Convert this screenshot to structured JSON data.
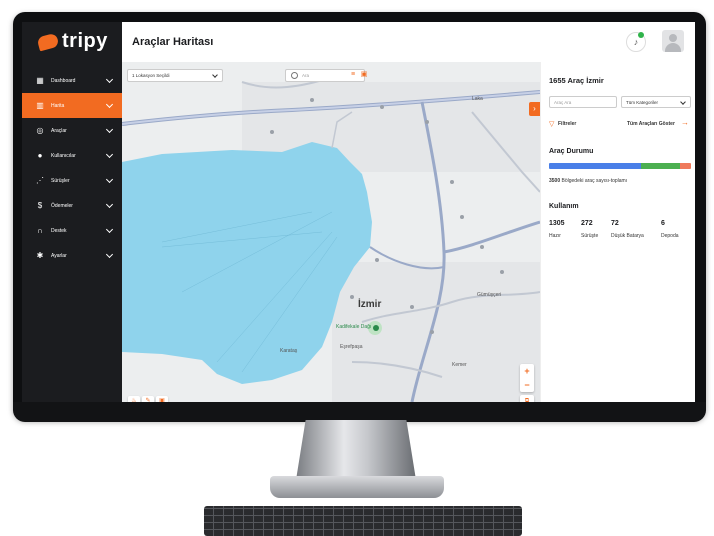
{
  "app": {
    "logo_text": "tripy",
    "page_title": "Araçlar Haritası"
  },
  "sidebar": {
    "items": [
      {
        "label": "Dashboard",
        "icon": "grid-icon",
        "active": false
      },
      {
        "label": "Harita",
        "icon": "map-icon",
        "active": true
      },
      {
        "label": "Araçlar",
        "icon": "scooter-icon",
        "active": false
      },
      {
        "label": "Kullanıcılar",
        "icon": "user-icon",
        "active": false
      },
      {
        "label": "Sürüşler",
        "icon": "route-icon",
        "active": false
      },
      {
        "label": "Ödemeler",
        "icon": "payment-icon",
        "active": false
      },
      {
        "label": "Destek",
        "icon": "headset-icon",
        "active": false
      },
      {
        "label": "Ayarlar",
        "icon": "gear-icon",
        "active": false
      }
    ]
  },
  "map": {
    "location_select": "1 Lokasyon Seçildi",
    "search_placeholder": "Ara",
    "city_label": "İzmir",
    "castle_label": "Kadifekale Dağı",
    "district_labels": [
      "Laka",
      "Karataş",
      "Eşrefpaşa",
      "Kemer",
      "Gümüşçeri"
    ]
  },
  "panel": {
    "title": "1655 Araç İzmir",
    "search_placeholder": "Araç Ara",
    "category_select": "Tüm Kategoriler",
    "filters_label": "Filtreler",
    "show_all_label": "Tüm Araçları Göster",
    "status_title": "Araç Durumu",
    "status_bar": [
      {
        "fraction": 0.65,
        "color": "#4a7fe8"
      },
      {
        "fraction": 0.27,
        "color": "#4caf50"
      },
      {
        "fraction": 0.08,
        "color": "#ef7a5c"
      }
    ],
    "count_value": "3500",
    "count_text": "Bölgedeki araç sayısı-toplamı",
    "usage_title": "Kullanım",
    "usage": [
      {
        "value": "1305",
        "label": "Hazır"
      },
      {
        "value": "272",
        "label": "Sürüşte"
      },
      {
        "value": "72",
        "label": "Düşük Batarya"
      },
      {
        "value": "6",
        "label": "Depoda"
      }
    ]
  },
  "colors": {
    "accent": "#f26b21",
    "sidebar_bg": "#1b1c1f",
    "water": "#8fd3ec"
  }
}
